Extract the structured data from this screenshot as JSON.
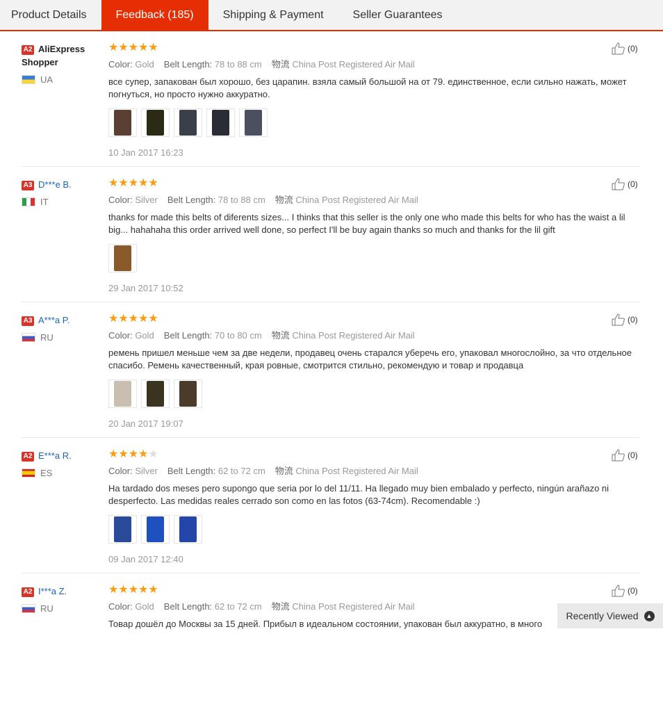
{
  "tabs": [
    {
      "label": "Product Details"
    },
    {
      "label": "Feedback (185)"
    },
    {
      "label": "Shipping & Payment"
    },
    {
      "label": "Seller Guarantees"
    }
  ],
  "labels": {
    "color": "Color:",
    "belt_length": "Belt Length:",
    "shipping_cn": "物流"
  },
  "reviews": [
    {
      "badge": "A2",
      "name_line1": "AliExpress",
      "name_line2": "Shopper",
      "country": "UA",
      "rating": 5,
      "color": "Gold",
      "belt_length": "78 to 88 cm",
      "shipping": "China Post Registered Air Mail",
      "text": "все супер, запакован был хорошо, без царапин. взяла самый большой на от 79. единственное, если сильно нажать, может погнуться, но просто нужно аккуратно.",
      "date": "10 Jan 2017 16:23",
      "useful": "(0)",
      "photos": [
        "#5a4032",
        "#2b2a14",
        "#3a3f4a",
        "#2a2d35",
        "#4a5060"
      ]
    },
    {
      "badge": "A3",
      "name_line1": "D***e B.",
      "name_line2": "",
      "country": "IT",
      "rating": 5,
      "color": "Silver",
      "belt_length": "78 to 88 cm",
      "shipping": "China Post Registered Air Mail",
      "text": "thanks for made this belts of diferents sizes... I thinks that this seller is the only one who made this belts for who has the waist a lil big... hahahaha this order arrived well done, so perfect I'll be buy again thanks so much and thanks for the lil gift",
      "date": "29 Jan 2017 10:52",
      "useful": "(0)",
      "photos": [
        "#8b5a2b"
      ]
    },
    {
      "badge": "A3",
      "name_line1": "A***a P.",
      "name_line2": "",
      "country": "RU",
      "rating": 5,
      "color": "Gold",
      "belt_length": "70 to 80 cm",
      "shipping": "China Post Registered Air Mail",
      "text": "ремень пришел меньше чем за две недели, продавец очень старался уберечь его, упаковал многослойно, за что отдельное спасибо. Ремень качественный, края ровные, смотрится стильно, рекомендую и товар и продавца",
      "date": "20 Jan 2017 19:07",
      "useful": "(0)",
      "photos": [
        "#c9bfb0",
        "#3a3320",
        "#4a3b2a"
      ]
    },
    {
      "badge": "A2",
      "name_line1": "E***a R.",
      "name_line2": "",
      "country": "ES",
      "rating": 4,
      "color": "Silver",
      "belt_length": "62 to 72 cm",
      "shipping": "China Post Registered Air Mail",
      "text": "Ha tardado dos meses pero supongo que seria por lo del 11/11. Ha llegado muy bien embalado y perfecto, ningún arañazo ni desperfecto. Las medidas reales cerrado son como en las fotos (63-74cm). Recomendable :)",
      "date": "09 Jan 2017 12:40",
      "useful": "(0)",
      "photos": [
        "#2a4a9a",
        "#1e50c0",
        "#2346a8"
      ]
    },
    {
      "badge": "A2",
      "name_line1": "I***a Z.",
      "name_line2": "",
      "country": "RU",
      "rating": 5,
      "color": "Gold",
      "belt_length": "62 to 72 cm",
      "shipping": "China Post Registered Air Mail",
      "text": "Товар дошёл до Москвы за 15 дней. Прибыл в идеальном состоянии, упакован был аккуратно, в много",
      "date": "",
      "useful": "(0)",
      "photos": []
    }
  ],
  "recently_viewed": "Recently Viewed",
  "colors": {
    "accent": "#e62e04",
    "star": "#ff9b0f",
    "badge": "#d8342a",
    "link": "#1c64b8"
  }
}
